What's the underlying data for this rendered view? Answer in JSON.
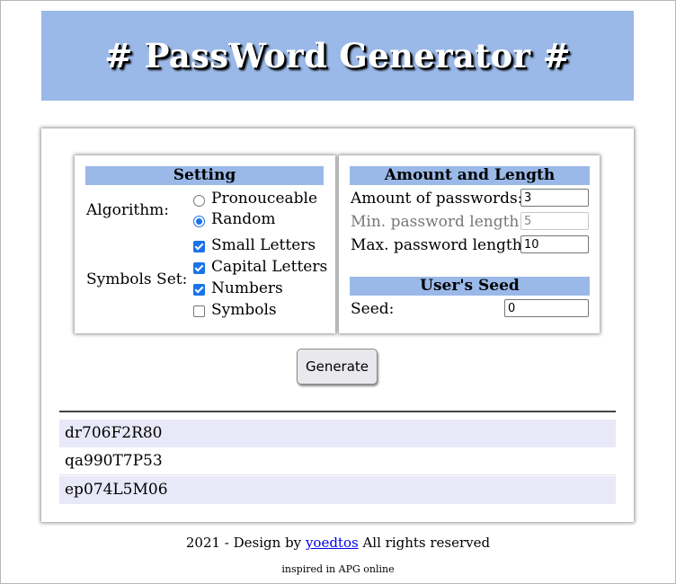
{
  "header": {
    "title": "# PassWord Generator #"
  },
  "settings": {
    "heading": "Setting",
    "algorithm_label": "Algorithm:",
    "algorithms": [
      {
        "label": "Pronouceable",
        "selected": false
      },
      {
        "label": "Random",
        "selected": true
      }
    ],
    "symbols_label": "Symbols Set:",
    "symbols": [
      {
        "label": "Small Letters",
        "checked": true
      },
      {
        "label": "Capital Letters",
        "checked": true
      },
      {
        "label": "Numbers",
        "checked": true
      },
      {
        "label": "Symbols",
        "checked": false
      }
    ]
  },
  "amount_length": {
    "heading": "Amount and Length",
    "amount_label": "Amount of passwords:",
    "amount_value": "3",
    "min_label": "Min. password length:",
    "min_value": "5",
    "max_label": "Max. password length:",
    "max_value": "10"
  },
  "seed": {
    "heading": "User's Seed",
    "label": "Seed:",
    "value": "0"
  },
  "generate_label": "Generate",
  "results": [
    "dr706F2R80",
    "qa990T7P53",
    "ep074L5M06"
  ],
  "footer": {
    "prefix": "2021 - Design by",
    "link": "yoedtos",
    "suffix": "All rights reserved",
    "sub": "inspired in APG online"
  },
  "colors": {
    "header_bg": "#9ab9e8",
    "accent": "#1a73e8",
    "row_shade": "#e8e8f8"
  }
}
